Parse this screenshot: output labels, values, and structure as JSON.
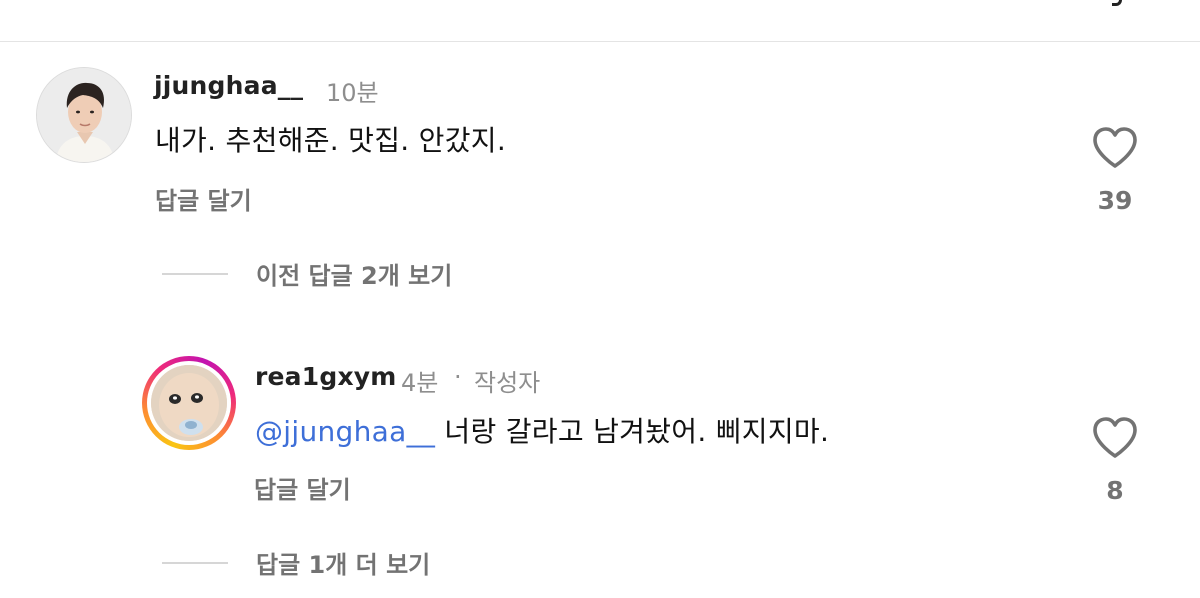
{
  "comments": [
    {
      "username": "jjunghaa__",
      "time": "10분",
      "text": "내가. 추천해준. 맛집. 안갔지.",
      "reply_label": "답글 달기",
      "like_count": "39"
    },
    {
      "username": "rea1gxym",
      "time": "4분",
      "separator": "·",
      "author_badge": "작성자",
      "mention": "@jjunghaa__",
      "text": "너랑 갈라고 남겨놨어. 삐지지마.",
      "reply_label": "답글 달기",
      "like_count": "8"
    }
  ],
  "threads": {
    "previous_replies": "이전 답글 2개 보기",
    "more_replies": "답글 1개 더 보기"
  },
  "icons": {
    "like": "heart-outline-icon"
  },
  "colors": {
    "mention": "#3e6fd8",
    "muted_text": "#737373",
    "story_ring": [
      "#f9c513",
      "#fd8d32",
      "#ee2a7b",
      "#c213b0"
    ]
  }
}
